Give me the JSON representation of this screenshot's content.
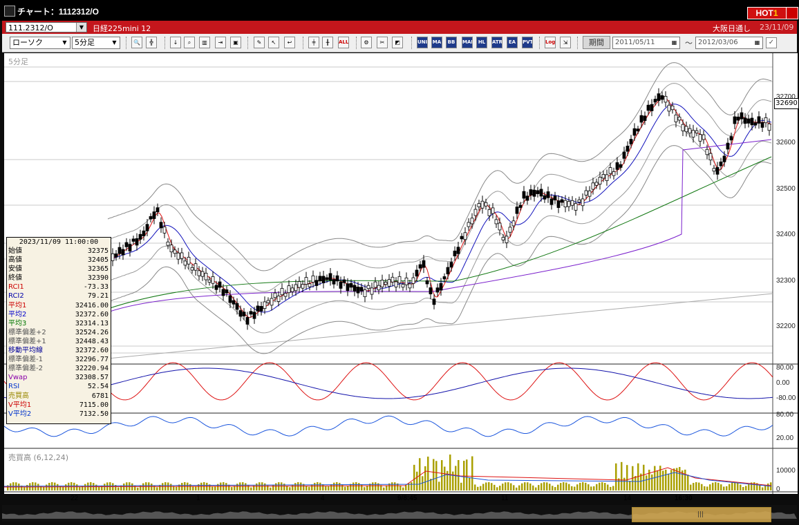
{
  "window": {
    "title": "チャート：1112312/O",
    "hot_label": "HOT",
    "hot_number": "1"
  },
  "header": {
    "code": "111.2312/O",
    "product": "日経225mini 12",
    "market": "大阪日通し",
    "date": "23/11/09"
  },
  "toolbar": {
    "chart_type": "ローソク",
    "interval": "5分足",
    "buttons": [
      "zoom-icon",
      "crosshair-icon",
      "arrow-down-icon",
      "search-icon",
      "bar-chart-icon",
      "split-icon",
      "lock-icon",
      "pen-icon",
      "cursor-icon",
      "undo-icon",
      "candle-a-icon",
      "candle-b-icon",
      "ALL",
      "gear-icon",
      "wrench-icon",
      "palette-icon",
      "UNI",
      "MA",
      "BB",
      "MAE",
      "HL",
      "ATR",
      "EA",
      "PVT",
      "Log",
      "export-icon"
    ],
    "period_label": "期間",
    "date_from": "2011/05/11",
    "date_to": "2012/03/06",
    "tilde": "〜"
  },
  "chart": {
    "interval_label": "5分足",
    "current_price_tag": "32690",
    "price_ticks": [
      "32700",
      "32600",
      "32500",
      "32400",
      "32300",
      "32200"
    ],
    "oscillator_ticks": [
      "80.00",
      "0.00",
      "-80.00"
    ],
    "rsi_ticks": [
      "80.00",
      "20.00"
    ],
    "volume_title": "売買高 (6,12,24)",
    "volume_ticks": [
      "10000",
      "0"
    ],
    "x_labels": [
      "22",
      "1",
      "4",
      "9/8:45",
      "11",
      "14",
      "16:30"
    ]
  },
  "info_panel": {
    "timestamp": "2023/11/09 11:00:00",
    "rows": [
      {
        "label": "始値",
        "value": "32375",
        "color": "#000000"
      },
      {
        "label": "高値",
        "value": "32405",
        "color": "#000000"
      },
      {
        "label": "安値",
        "value": "32365",
        "color": "#000000"
      },
      {
        "label": "終値",
        "value": "32390",
        "color": "#000000"
      },
      {
        "label": "RCI1",
        "value": "-73.33",
        "color": "#cc0000"
      },
      {
        "label": "RCI2",
        "value": "79.21",
        "color": "#0000aa"
      },
      {
        "label": "平均1",
        "value": "32416.00",
        "color": "#cc0000"
      },
      {
        "label": "平均2",
        "value": "32372.60",
        "color": "#0000cc"
      },
      {
        "label": "平均3",
        "value": "32314.13",
        "color": "#007700"
      },
      {
        "label": "標準偏差+2",
        "value": "32524.26",
        "color": "#555555"
      },
      {
        "label": "標準偏差+1",
        "value": "32448.43",
        "color": "#555555"
      },
      {
        "label": "移動平均線",
        "value": "32372.60",
        "color": "#000099"
      },
      {
        "label": "標準偏差-1",
        "value": "32296.77",
        "color": "#555555"
      },
      {
        "label": "標準偏差-2",
        "value": "32220.94",
        "color": "#555555"
      },
      {
        "label": "Vwap",
        "value": "32308.57",
        "color": "#8800aa"
      },
      {
        "label": "RSI",
        "value": "52.54",
        "color": "#0033cc"
      },
      {
        "label": "売買高",
        "value": "6781",
        "color": "#998800"
      },
      {
        "label": "V平均1",
        "value": "7115.00",
        "color": "#cc0000"
      },
      {
        "label": "V平均2",
        "value": "7132.50",
        "color": "#0033cc"
      }
    ]
  },
  "colors": {
    "titlebar": "#000000",
    "header_bar": "#c4161c",
    "ma1": "#dd1111",
    "ma2": "#1111bb",
    "ma3": "#117711",
    "vwap": "#7a1fcc",
    "bands": "#555555",
    "volume": "#aaa000",
    "rsi": "#1a55dd"
  }
}
